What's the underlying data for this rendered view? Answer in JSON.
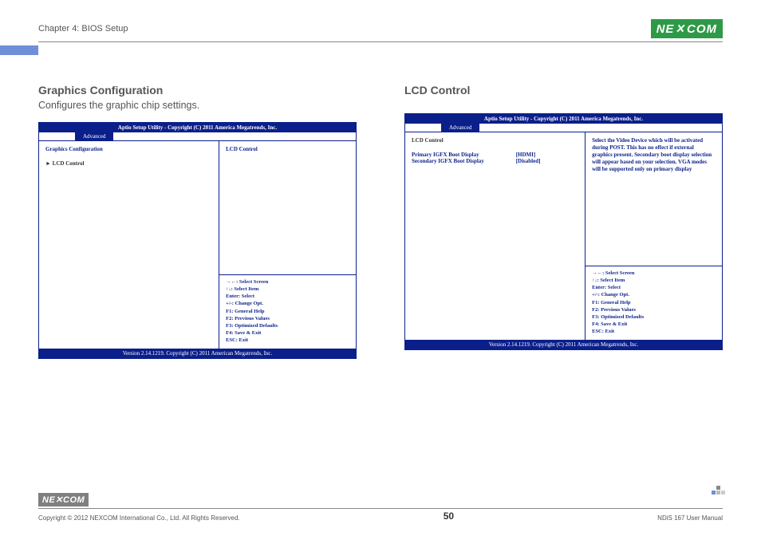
{
  "header": {
    "chapter": "Chapter 4: BIOS Setup",
    "logo_text": "NE COM",
    "logo_x": "✕"
  },
  "left_section": {
    "title": "Graphics Configuration",
    "desc": "Configures the graphic chip settings."
  },
  "right_section": {
    "title": "LCD Control"
  },
  "bios_common": {
    "top": "Aptio Setup Utility - Copyright (C) 2011 America Megatrends, Inc.",
    "tab_active": "Advanced",
    "bottom": "Version 2.14.1219. Copyright (C) 2011 American Megatrends, Inc."
  },
  "bios_left": {
    "heading": "Graphics Configuration",
    "menu_item": "► LCD Control",
    "help_top": "LCD Control",
    "keys": {
      "k1": "→←: Select Screen",
      "k2": "↑↓: Select Item",
      "k3": "Enter: Select",
      "k4": "+/-: Change Opt.",
      "k5": "F1: General Help",
      "k6": "F2: Previous Values",
      "k7": "F3: Optimized Defaults",
      "k8": "F4: Save & Exit",
      "k9": "ESC: Exit"
    }
  },
  "bios_right": {
    "heading": "LCD Control",
    "row1_label": "Primary IGFX Boot Display",
    "row1_value": "[HDMI]",
    "row2_label": "Secondary IGFX Boot Display",
    "row2_value": "[Disabled]",
    "help_top": "Select the Video Device which will be activated during POST. This has no effect if external graphics present. Secondary boot display selection will appear based on your selection. VGA modes will be supported only on primary display",
    "keys": {
      "k1": "→←: Select Screen",
      "k2": "↑↓: Select Item",
      "k3": "Enter: Select",
      "k4": "+/-: Change Opt.",
      "k5": "F1: General Help",
      "k6": "F2: Previous Values",
      "k7": "F3: Optimized Defaults",
      "k8": "F4: Save & Exit",
      "k9": "ESC: Exit"
    }
  },
  "footer": {
    "logo": "NE✕COM",
    "copyright": "Copyright © 2012 NEXCOM International Co., Ltd. All Rights Reserved.",
    "page": "50",
    "manual": "NDiS 167 User Manual"
  }
}
